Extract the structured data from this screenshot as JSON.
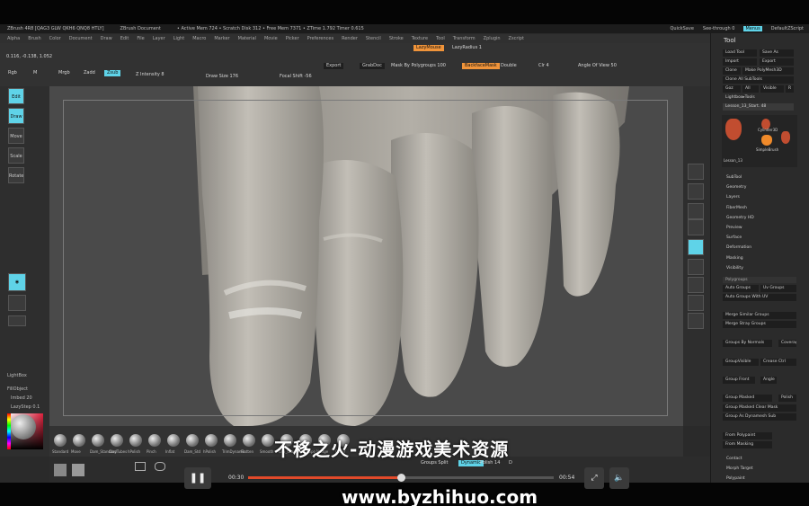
{
  "title_bar": {
    "app": "ZBrush 4R8 [QAG3 GLW QKH6 QNQ8 HTLY]",
    "document": "ZBrush Document",
    "stats": "• Active Mem 724 • Scratch Disk 312 • Free Mem 7371 • ZTime 1.792 Timer 0.615",
    "quicksave": "QuickSave",
    "seethrough": "See-through 0",
    "menus": "Menus",
    "defaultzscript": "DefaultZScript"
  },
  "menu": [
    "Alpha",
    "Brush",
    "Color",
    "Document",
    "Draw",
    "Edit",
    "File",
    "Layer",
    "Light",
    "Macro",
    "Marker",
    "Material",
    "Movie",
    "Picker",
    "Preferences",
    "Render",
    "Stencil",
    "Stroke",
    "Texture",
    "Tool",
    "Transform",
    "Zplugin",
    "Zscript"
  ],
  "top_controls": {
    "lazymouse": "LazyMouse",
    "lazyradius": "LazyRadius 1",
    "rgb": "Rgb",
    "m": "M",
    "mrgb": "Mrgb",
    "zadd": "Zadd",
    "zsub": "Zsub",
    "zintensity": "Z Intensity 8",
    "drawsize": "Draw Size 176",
    "focalshift": "Focal Shift -56",
    "export": "Export",
    "grabdoc": "GrabDoc",
    "mask_by_polygroups": "Mask By Polygroups 100",
    "backfacemask": "BackfaceMask",
    "double": "Double",
    "clr": "Clr 4",
    "angle_of_view": "Angle Of View 50",
    "coords": "0.116, -0.138, 1.052"
  },
  "left_shelf": [
    "Edit",
    "Draw",
    "Move",
    "Scale",
    "Rotate"
  ],
  "left_labels": {
    "lightbox": "LightBox",
    "fillobject": "FillObject",
    "imbed": "Imbed 20",
    "lazystep": "LazyStep 0.1"
  },
  "right_shelf": [
    "Actual",
    "AAHalf",
    "Dynamic",
    "Persp",
    "Floor",
    "Local",
    "Frame",
    "Move",
    "Scale",
    "Rotate"
  ],
  "tool_panel": {
    "title": "Tool",
    "buttons": [
      "Load Tool",
      "Save As",
      "Import",
      "Export",
      "Clone",
      "Make PolyMesh3D",
      "Clone All SubTools",
      "Goz",
      "All",
      "Visible",
      "R"
    ],
    "lightbox_tools": "Lightbox▸Tools",
    "current_tool": "Lesson_13_Start. 48",
    "thumb_labels": [
      "Cylinder3D",
      "SimpleBrush",
      "Lesson_13"
    ],
    "sections": [
      "SubTool",
      "Geometry",
      "Layers",
      "FiberMesh",
      "Geometry HD",
      "Preview",
      "Surface",
      "Deformation",
      "Masking",
      "Visibility"
    ],
    "polygroups_head": "Polygroups",
    "polygroup_buttons": [
      "Auto Groups",
      "Uv Groups",
      "Auto Groups With UV",
      "Merge Similar Groups",
      "Merge Stray Groups",
      "Groups By Normals",
      "Coverage",
      "GroupVisible",
      "Crease Ctrl",
      "Group Front",
      "Angle",
      "Group Masked",
      "Polish",
      "Group Masked Clear Mask",
      "Group As Dynamesh Sub",
      "From Polypaint",
      "From Masking"
    ],
    "bottom_items": [
      "Contact",
      "Morph Target",
      "Polypaint"
    ]
  },
  "brushes": [
    "Standard",
    "Move",
    "Dam_Standard",
    "ClayTubes",
    "hPolish",
    "Pinch",
    "Inflat",
    "Dam_Std",
    "hPolish",
    "TrimDynamic",
    "Flatten",
    "Smooth",
    "Orb_Cracks",
    "MoveTopo",
    "Nudge",
    "Other"
  ],
  "bottom_small": {
    "groups_split": "Groups Split",
    "polish": "Polish",
    "dynamic": "Dynamic",
    "polish_val": "Polish 14",
    "d": "D"
  },
  "player": {
    "current_time": "00:30",
    "total_time": "00:54",
    "progress": 0.5
  },
  "watermark": {
    "cn": "不移之火-动漫游戏美术资源",
    "url": "www.byzhihuo.com"
  },
  "colors": {
    "accent_orange": "#f0943a",
    "accent_cyan": "#5fd3e8",
    "progress_red": "#e24a2a",
    "model_gray": "#b7b3ac"
  }
}
